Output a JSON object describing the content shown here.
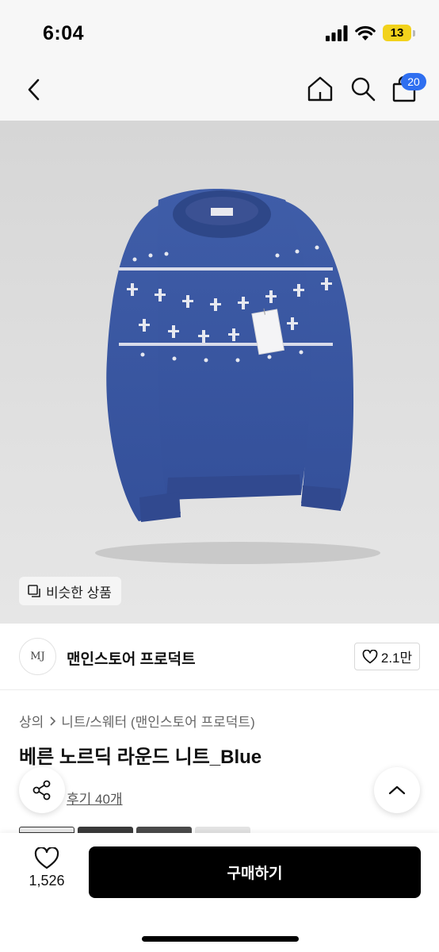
{
  "status_bar": {
    "time": "6:04",
    "battery_level": "13",
    "icons": [
      "cellular-signal-icon",
      "wifi-icon",
      "battery-icon"
    ]
  },
  "nav": {
    "back_icon": "chevron-left-icon",
    "home_icon": "home-icon",
    "search_icon": "search-icon",
    "cart_icon": "shopping-bag-icon",
    "cart_count": "20"
  },
  "product": {
    "image_subject": "blue nordic pattern round knit sweater",
    "similar_label": "비슷한 상품",
    "brand_logo_text": "MJ",
    "brand_name": "맨인스토어 프로덕트",
    "like_count": "2.1만",
    "breadcrumb": [
      "상의",
      "니트/스웨터 (맨인스토어 프로덕트)"
    ],
    "title": "베른 노르딕 라운드 니트_Blue",
    "review_text": "후기 40개"
  },
  "bottom_bar": {
    "wish_count": "1,526",
    "buy_label": "구매하기"
  },
  "colors": {
    "accent_badge": "#2f6ff0",
    "buy_button": "#000000",
    "sweater_blue": "#3a55a0"
  }
}
